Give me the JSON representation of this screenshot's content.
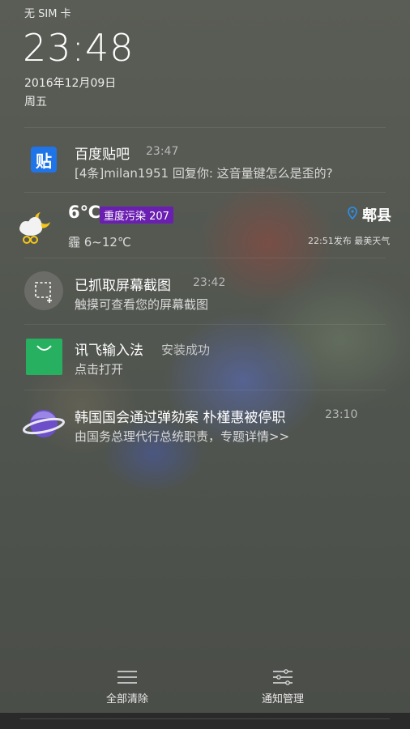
{
  "status_bar": {
    "carrier": "无 SIM 卡"
  },
  "lockscreen": {
    "time": "23:48",
    "date": "2016年12月09日",
    "weekday": "周五"
  },
  "notifications": [
    {
      "app": "百度贴吧",
      "icon": "tieba-icon",
      "icon_text": "贴",
      "title": "百度贴吧",
      "time": "23:47",
      "body": "[4条]milan1951 回复你: 这音量键怎么是歪的?",
      "icon_color": "#1f74e8"
    },
    {
      "app": "weather",
      "icon": "weather-cloud-sun-icon",
      "temperature": "6℃",
      "aqi_badge": "重度污染 207",
      "aqi_color": "#6a1fb0",
      "location": "郫县",
      "condition_range": "霾 6~12℃",
      "published": "22:51发布 最美天气"
    },
    {
      "app": "screenshot",
      "icon": "screenshot-icon",
      "title": "已抓取屏幕截图",
      "time": "23:42",
      "body": "触摸可查看您的屏幕截图"
    },
    {
      "app": "讯飞输入法",
      "icon": "ifly-bag-icon",
      "title": "讯飞输入法",
      "status": "安装成功",
      "body": "点击打开",
      "icon_color": "#27b060"
    },
    {
      "app": "news",
      "icon": "planet-icon",
      "title": "韩国国会通过弹劾案 朴槿惠被停职",
      "time": "23:10",
      "body": "由国务总理代行总统职责，专题详情>>"
    }
  ],
  "bottom_actions": {
    "clear_all": "全部清除",
    "manage": "通知管理"
  }
}
